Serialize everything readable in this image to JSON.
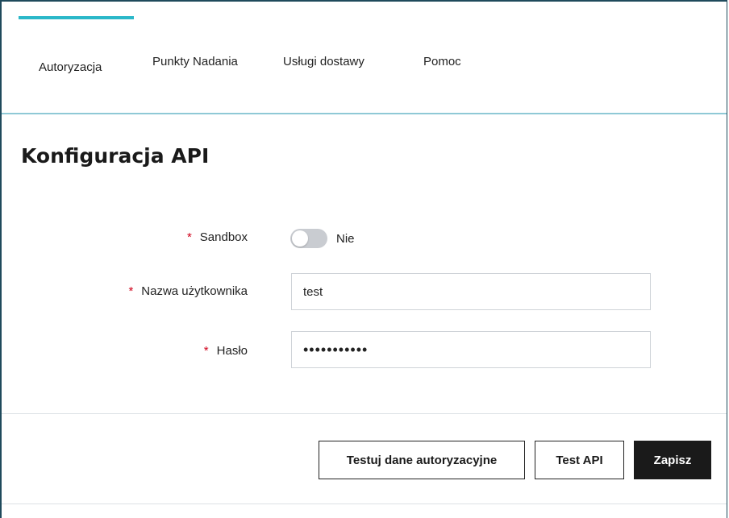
{
  "tabs": [
    {
      "label": "Autoryzacja",
      "active": true
    },
    {
      "label": "Punkty Nadania",
      "active": false
    },
    {
      "label": "Usługi dostawy",
      "active": false
    },
    {
      "label": "Pomoc",
      "active": false
    }
  ],
  "page": {
    "title": "Konfiguracja API"
  },
  "form": {
    "required_mark": "*",
    "sandbox": {
      "label": "Sandbox",
      "value": false,
      "state_text": "Nie"
    },
    "username": {
      "label": "Nazwa użytkownika",
      "value": "test"
    },
    "password": {
      "label": "Hasło",
      "value": "•••••••••••"
    }
  },
  "actions": {
    "test_auth_label": "Testuj dane autoryzacyjne",
    "test_api_label": "Test API",
    "save_label": "Zapisz"
  },
  "colors": {
    "accent": "#2bb8c9",
    "required": "#d0021b",
    "primary_button": "#1a1a1a"
  }
}
